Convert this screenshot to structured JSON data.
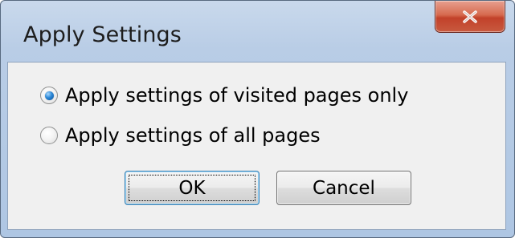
{
  "window": {
    "title": "Apply Settings"
  },
  "options": [
    {
      "label": "Apply settings of visited pages only",
      "selected": true
    },
    {
      "label": "Apply settings of all pages",
      "selected": false
    }
  ],
  "buttons": {
    "ok_label": "OK",
    "cancel_label": "Cancel"
  },
  "icons": {
    "close": "close-icon"
  },
  "colors": {
    "close_button": "#c8482e",
    "radio_selected": "#2a87d6",
    "default_button_border": "#3c7fb1"
  }
}
